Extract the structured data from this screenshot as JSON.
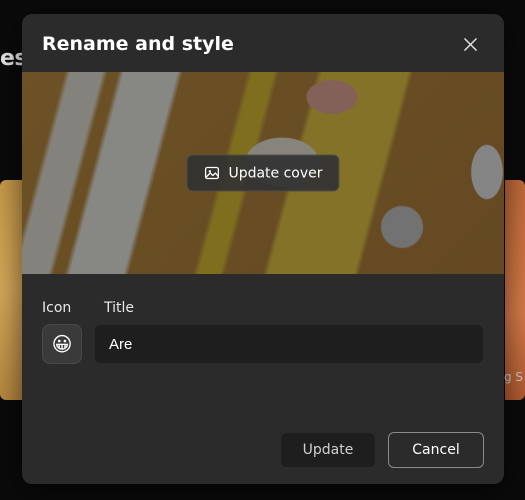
{
  "background": {
    "partial_text_left": "es",
    "partial_text_right": "g S"
  },
  "modal": {
    "title": "Rename and style",
    "cover": {
      "update_label": "Update cover"
    },
    "form": {
      "icon_label": "Icon",
      "title_label": "Title",
      "icon_value": "😀",
      "title_value": "Are"
    },
    "buttons": {
      "update": "Update",
      "cancel": "Cancel"
    }
  }
}
